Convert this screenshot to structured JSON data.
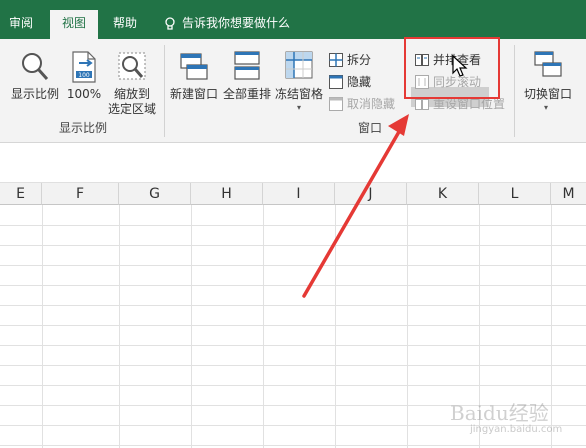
{
  "tabs": [
    {
      "label": "审阅",
      "active": false
    },
    {
      "label": "视图",
      "active": true
    },
    {
      "label": "帮助",
      "active": false
    }
  ],
  "tell_me": {
    "label": "告诉我你想要做什么",
    "icon": "lightbulb-icon"
  },
  "ribbon": {
    "zoom_group": {
      "group_label": "显示比例",
      "buttons": [
        {
          "label": "显示比例",
          "icon": "zoom-magnifier-icon"
        },
        {
          "label": "100%",
          "icon": "zoom-100-icon"
        },
        {
          "label_line1": "缩放到",
          "label_line2": "选定区域",
          "icon": "zoom-to-selection-icon"
        }
      ]
    },
    "window_group": {
      "group_label": "窗口",
      "big_buttons": [
        {
          "label": "新建窗口",
          "icon": "new-window-icon"
        },
        {
          "label": "全部重排",
          "icon": "arrange-all-icon"
        },
        {
          "label": "冻结窗格",
          "icon": "freeze-panes-icon",
          "dropdown": true
        }
      ],
      "small_buttons": [
        {
          "label": "拆分",
          "icon": "split-icon",
          "enabled": true
        },
        {
          "label": "隐藏",
          "icon": "hide-icon",
          "enabled": true
        },
        {
          "label": "取消隐藏",
          "icon": "unhide-icon",
          "enabled": false
        },
        {
          "label": "并排查看",
          "icon": "side-by-side-icon",
          "enabled": true,
          "highlighted": true
        },
        {
          "label": "同步滚动",
          "icon": "sync-scroll-icon",
          "enabled": false
        },
        {
          "label": "重设窗口位置",
          "icon": "reset-window-icon",
          "enabled": false
        }
      ],
      "switch_button": {
        "label": "切换窗口",
        "icon": "switch-windows-icon",
        "dropdown": true
      }
    }
  },
  "columns": [
    "E",
    "F",
    "G",
    "H",
    "I",
    "J",
    "K",
    "L",
    "M"
  ],
  "watermark": {
    "main": "Baidu经验",
    "sub": "jingyan.baidu.com"
  },
  "colors": {
    "brand": "#217346",
    "ribbon_bg": "#f3f3f3",
    "highlight": "#e53935"
  }
}
